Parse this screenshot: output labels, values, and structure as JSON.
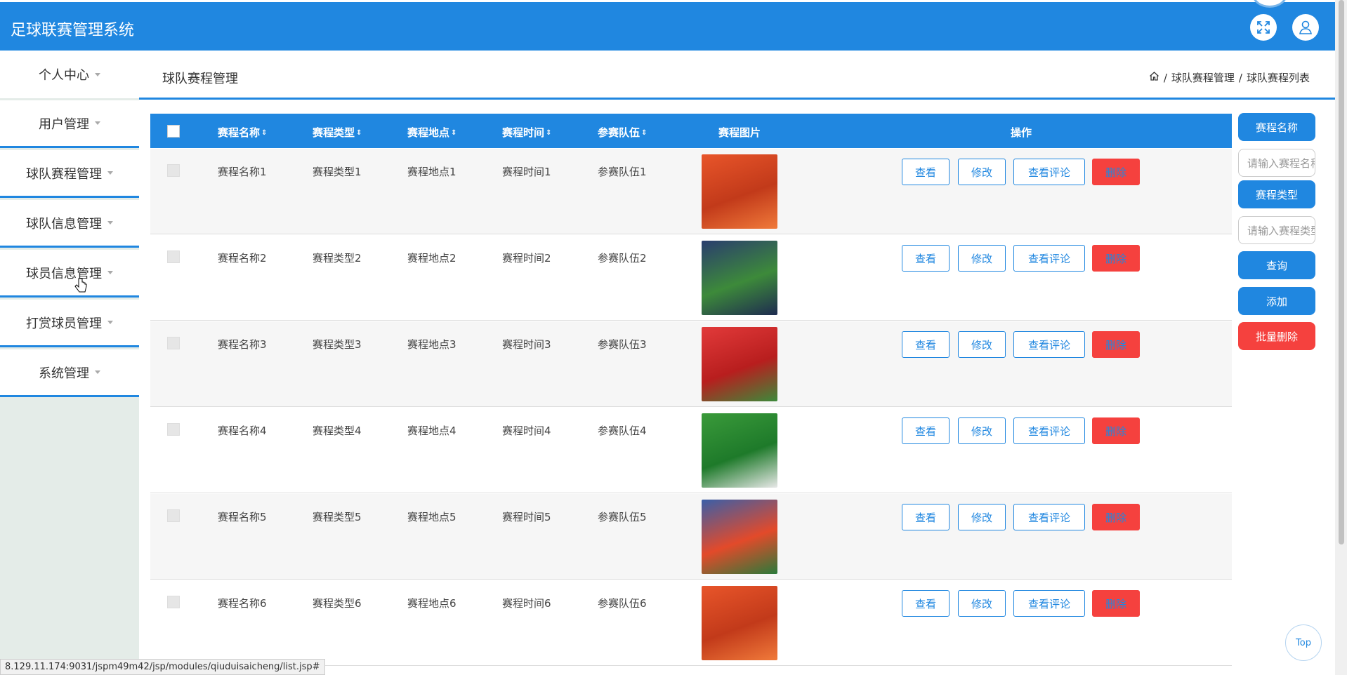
{
  "app": {
    "title": "足球联赛管理系统"
  },
  "sidebar": {
    "items": [
      {
        "label": "个人中心"
      },
      {
        "label": "用户管理"
      },
      {
        "label": "球队赛程管理"
      },
      {
        "label": "球队信息管理"
      },
      {
        "label": "球员信息管理"
      },
      {
        "label": "打赏球员管理"
      },
      {
        "label": "系统管理"
      }
    ]
  },
  "header": {
    "page_title": "球队赛程管理",
    "breadcrumb": [
      "球队赛程管理",
      "球队赛程列表"
    ],
    "separator": "/"
  },
  "table": {
    "columns": [
      "赛程名称",
      "赛程类型",
      "赛程地点",
      "赛程时间",
      "参赛队伍",
      "赛程图片",
      "操作"
    ],
    "rows": [
      {
        "name": "赛程名称1",
        "type": "赛程类型1",
        "place": "赛程地点1",
        "time": "赛程时间1",
        "team": "参赛队伍1"
      },
      {
        "name": "赛程名称2",
        "type": "赛程类型2",
        "place": "赛程地点2",
        "time": "赛程时间2",
        "team": "参赛队伍2"
      },
      {
        "name": "赛程名称3",
        "type": "赛程类型3",
        "place": "赛程地点3",
        "time": "赛程时间3",
        "team": "参赛队伍3"
      },
      {
        "name": "赛程名称4",
        "type": "赛程类型4",
        "place": "赛程地点4",
        "time": "赛程时间4",
        "team": "参赛队伍4"
      },
      {
        "name": "赛程名称5",
        "type": "赛程类型5",
        "place": "赛程地点5",
        "time": "赛程时间5",
        "team": "参赛队伍5"
      },
      {
        "name": "赛程名称6",
        "type": "赛程类型6",
        "place": "赛程地点6",
        "time": "赛程时间6",
        "team": "参赛队伍6"
      }
    ],
    "actions": {
      "view": "查看",
      "edit": "修改",
      "comments": "查看评论",
      "delete": "删除"
    }
  },
  "search": {
    "name_label": "赛程名称",
    "name_placeholder": "请输入赛程名称",
    "type_label": "赛程类型",
    "type_placeholder": "请输入赛程类型",
    "query": "查询",
    "add": "添加",
    "batch_delete": "批量删除"
  },
  "top_button": "Top",
  "status_url": "8.129.11.174:9031/jspm49m42/jsp/modules/qiuduisaicheng/list.jsp#",
  "colors": {
    "primary": "#2087e0",
    "danger": "#f5413e"
  }
}
